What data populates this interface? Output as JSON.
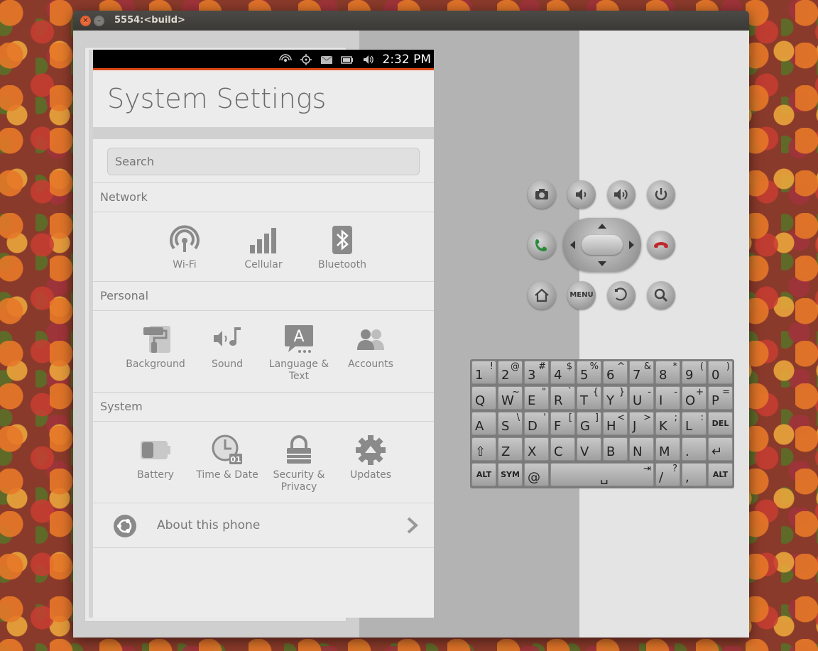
{
  "window": {
    "title": "5554:<build>"
  },
  "status_bar": {
    "time": "2:32 PM"
  },
  "settings": {
    "title": "System Settings",
    "search_placeholder": "Search",
    "sections": {
      "network": {
        "label": "Network",
        "items": [
          "Wi-Fi",
          "Cellular",
          "Bluetooth"
        ]
      },
      "personal": {
        "label": "Personal",
        "items": [
          "Background",
          "Sound",
          "Language & Text",
          "Accounts"
        ]
      },
      "system": {
        "label": "System",
        "items": [
          "Battery",
          "Time & Date",
          "Security & Privacy",
          "Updates"
        ]
      }
    },
    "about": "About this phone"
  },
  "hardware": {
    "menu_label": "MENU"
  },
  "keyboard": {
    "rows": [
      [
        [
          "1",
          "!"
        ],
        [
          "2",
          "@"
        ],
        [
          "3",
          "#"
        ],
        [
          "4",
          "$"
        ],
        [
          "5",
          "%"
        ],
        [
          "6",
          "^"
        ],
        [
          "7",
          "&"
        ],
        [
          "8",
          "*"
        ],
        [
          "9",
          "("
        ],
        [
          "0",
          ")"
        ]
      ],
      [
        [
          "Q",
          ""
        ],
        [
          "W",
          "~"
        ],
        [
          "E",
          "\""
        ],
        [
          "R",
          "`"
        ],
        [
          "T",
          "{"
        ],
        [
          "Y",
          "}"
        ],
        [
          "U",
          "-"
        ],
        [
          "I",
          "-"
        ],
        [
          "O",
          "+"
        ],
        [
          "P",
          "="
        ]
      ],
      [
        [
          "A",
          ""
        ],
        [
          "S",
          "\\"
        ],
        [
          "D",
          "'"
        ],
        [
          "F",
          "["
        ],
        [
          "G",
          "]"
        ],
        [
          "H",
          "<"
        ],
        [
          "J",
          ">"
        ],
        [
          "K",
          ";"
        ],
        [
          "L",
          ":"
        ],
        [
          "DEL",
          ""
        ]
      ],
      [
        [
          "⇧",
          ""
        ],
        [
          "Z",
          ""
        ],
        [
          "X",
          ""
        ],
        [
          "C",
          ""
        ],
        [
          "V",
          ""
        ],
        [
          "B",
          ""
        ],
        [
          "N",
          ""
        ],
        [
          "M",
          ""
        ],
        [
          ".",
          ""
        ],
        [
          "↵",
          ""
        ]
      ]
    ],
    "bottom": {
      "alt_left": "ALT",
      "sym": "SYM",
      "at": "@",
      "space": "␣",
      "tab": "⇥",
      "slash": "/",
      "slash_alt": "?",
      "comma": ",",
      "alt_right": "ALT"
    }
  },
  "colors": {
    "accent": "#dd4814",
    "call_green": "#2a8a3a",
    "end_red": "#c0282a"
  }
}
